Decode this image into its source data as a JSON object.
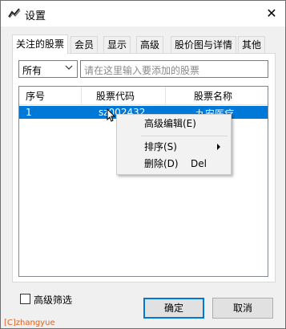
{
  "window": {
    "title": "设置",
    "close_glyph": "✕",
    "icon": "chart-line-icon"
  },
  "tabs": [
    {
      "label": "关注的股票",
      "active": true
    },
    {
      "label": "会员",
      "active": false
    },
    {
      "label": "显示",
      "active": false
    },
    {
      "label": "高级",
      "active": false
    },
    {
      "label": "股价图与详情",
      "active": false
    },
    {
      "label": "其他",
      "active": false
    }
  ],
  "filter": {
    "selected": "所有"
  },
  "search": {
    "placeholder": "请在这里输入要添加的股票"
  },
  "table": {
    "columns": [
      "序号",
      "股票代码",
      "股票名称"
    ],
    "rows": [
      {
        "index": "1",
        "code": "sz002432",
        "name": "九安医疗"
      }
    ]
  },
  "context_menu": {
    "items": [
      {
        "label": "高级编辑(E)",
        "shortcut": "",
        "submenu": false
      },
      {
        "label": "排序(S)",
        "shortcut": "",
        "submenu": true
      },
      {
        "label": "删除(D)",
        "shortcut": "Del",
        "submenu": false
      }
    ]
  },
  "advanced_filter": {
    "label": "高级筛选",
    "checked": false
  },
  "buttons": {
    "ok": "确定",
    "cancel": "取消"
  },
  "watermark": "[C]zhangyue",
  "colors": {
    "selection": "#0078d7",
    "accent": "#0078d7",
    "watermark": "#e06020"
  }
}
